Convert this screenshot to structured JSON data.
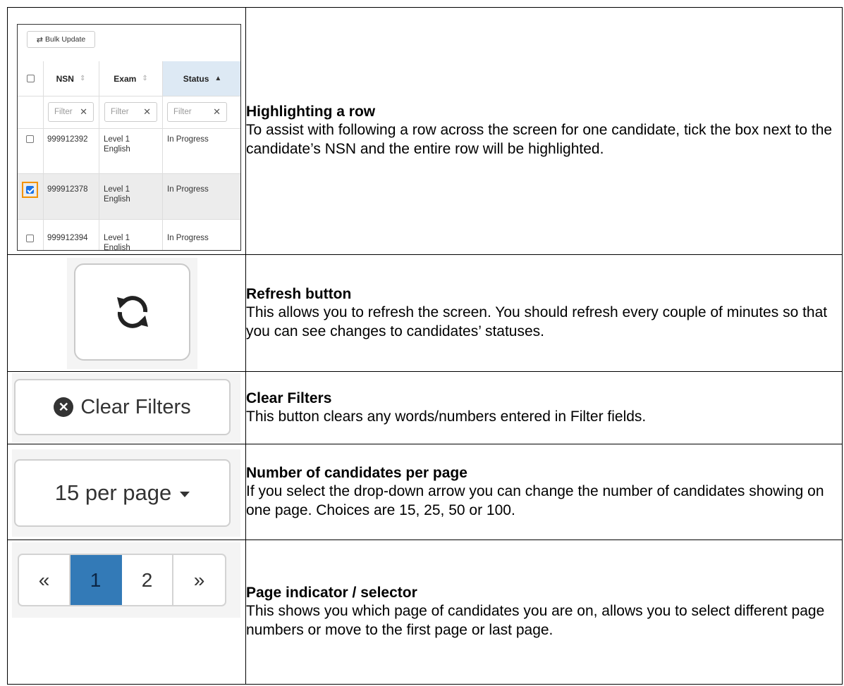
{
  "rows": [
    {
      "title": "Highlighting a row",
      "description": "To assist with following a row across the screen for one candidate, tick the box next to the candidate’s NSN and the entire row will be highlighted."
    },
    {
      "title": "Refresh button",
      "description": "This allows you to refresh the screen. You should refresh every couple of minutes so that you can see changes to candidates’ statuses."
    },
    {
      "title": "Clear Filters",
      "description": "This button clears any words/numbers entered in Filter fields."
    },
    {
      "title": "Number of candidates per page",
      "description": "If you select the drop-down arrow you can change the number of candidates showing on one page. Choices are 15, 25, 50 or 100."
    },
    {
      "title": "Page indicator / selector",
      "description": "This shows you which page of candidates you are on, allows you to select different page numbers or move to the first page or last page."
    }
  ],
  "grid": {
    "bulk_update_label": "Bulk Update",
    "columns": [
      "NSN",
      "Exam",
      "Status"
    ],
    "sorted_column": "Status",
    "filter_placeholder": "Filter",
    "candidates": [
      {
        "nsn": "999912392",
        "exam_line1": "Level 1",
        "exam_line2": "English",
        "status": "In Progress",
        "checked": false
      },
      {
        "nsn": "999912378",
        "exam_line1": "Level 1",
        "exam_line2": "English",
        "status": "In Progress",
        "checked": true
      },
      {
        "nsn": "999912394",
        "exam_line1": "Level 1",
        "exam_line2": "English",
        "status": "In Progress",
        "checked": false
      }
    ]
  },
  "clear_filters_label": "Clear Filters",
  "per_page_label": "15 per page",
  "pagination": {
    "first": "«",
    "pages": [
      "1",
      "2"
    ],
    "current": "1",
    "last": "»"
  },
  "colors": {
    "highlight_border": "#f39200",
    "active_page": "#337ab7",
    "sorted_header": "#dde9f4"
  }
}
